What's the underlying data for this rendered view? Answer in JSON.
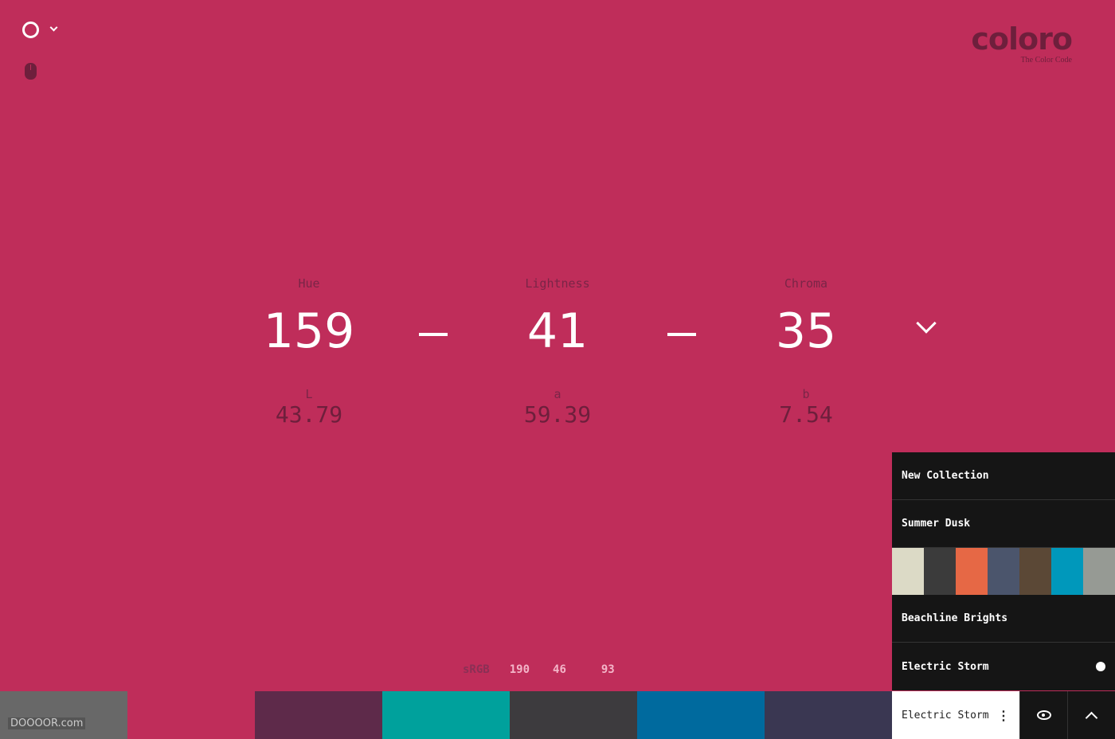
{
  "logo": {
    "word": "coloro",
    "tagline": "The Color Code"
  },
  "icons": {
    "mode": "circle-icon",
    "dropdown": "chevron-down-icon",
    "mouse": "mouse-icon"
  },
  "code": {
    "hue": {
      "label": "Hue",
      "value": "159"
    },
    "lightness": {
      "label": "Lightness",
      "value": "41"
    },
    "chroma": {
      "label": "Chroma",
      "value": "35"
    }
  },
  "lab": {
    "L": {
      "label": "L",
      "value": "43.79"
    },
    "a": {
      "label": "a",
      "value": "59.39"
    },
    "b": {
      "label": "b",
      "value": "7.54"
    }
  },
  "rgb": {
    "label": "sRGB",
    "r": "190",
    "g": "46",
    "b": "93"
  },
  "background": "#bf2d5a",
  "swatches": [
    "#686868",
    "#bf2d5a",
    "#5e2a4a",
    "#00a19c",
    "#3d3b3e",
    "#006a9e",
    "#3a3752"
  ],
  "watermark": "DOOOOR.com",
  "collections": {
    "items": [
      {
        "label": "New Collection"
      },
      {
        "label": "Summer Dusk"
      },
      {
        "label": "Beachline Brights"
      },
      {
        "label": "Electric Storm"
      }
    ],
    "summer_palette": [
      "#dcdac6",
      "#3b3b3b",
      "#e66845",
      "#4b556c",
      "#5b4836",
      "#0098bb",
      "#969a94"
    ],
    "current": "Electric Storm"
  }
}
